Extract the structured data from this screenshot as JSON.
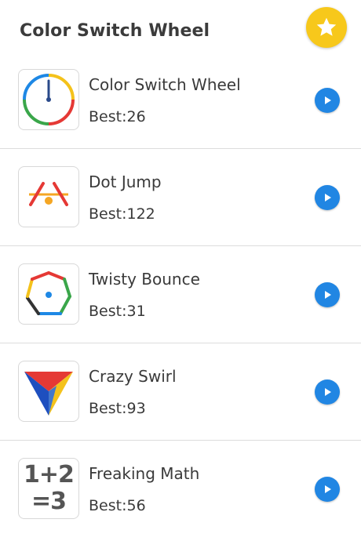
{
  "header": {
    "title": "Color Switch Wheel",
    "favorite_icon": "star-icon",
    "favorite_color": "#f7c81b"
  },
  "games": [
    {
      "name": "Color Switch Wheel",
      "best": "Best:26",
      "icon": "color-wheel-icon"
    },
    {
      "name": "Dot Jump",
      "best": "Best:122",
      "icon": "dot-jump-icon"
    },
    {
      "name": "Twisty Bounce",
      "best": "Best:31",
      "icon": "twisty-bounce-icon"
    },
    {
      "name": "Crazy Swirl",
      "best": "Best:93",
      "icon": "crazy-swirl-icon"
    },
    {
      "name": "Freaking Math",
      "best": "Best:56",
      "icon": "freaking-math-icon",
      "icon_text_top": "1+2",
      "icon_text_bottom": "=3"
    }
  ],
  "play_icon": "play-icon",
  "play_color": "#2186e3"
}
